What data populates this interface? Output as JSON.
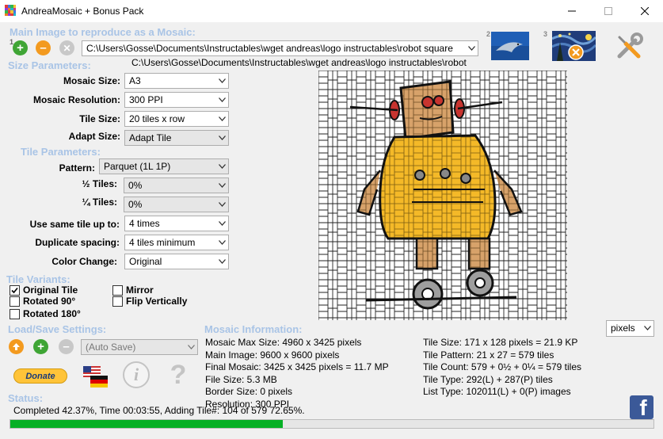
{
  "window": {
    "title": "AndreaMosaic + Bonus Pack"
  },
  "main_image": {
    "section_label": "Main Image to reproduce as a Mosaic:",
    "path_value": "C:\\Users\\Gosse\\Documents\\Instructables\\wget andreas\\logo instructables\\robot square",
    "path_caption": "C:\\Users\\Gosse\\Documents\\Instructables\\wget andreas\\logo instructables\\robot",
    "badge_add": "1",
    "badge_dolphin": "2",
    "badge_starry": "3"
  },
  "size_params": {
    "section_label": "Size Parameters:",
    "mosaic_size_label": "Mosaic Size:",
    "mosaic_size_value": "A3",
    "mosaic_resolution_label": "Mosaic Resolution:",
    "mosaic_resolution_value": "300 PPI",
    "tile_size_label": "Tile Size:",
    "tile_size_value": "20 tiles x row",
    "adapt_size_label": "Adapt Size:",
    "adapt_size_value": "Adapt Tile"
  },
  "tile_params": {
    "section_label": "Tile Parameters:",
    "pattern_label": "Pattern:",
    "pattern_value": "Parquet (1L 1P)",
    "half_tiles_label": "½ Tiles:",
    "half_tiles_value": "0%",
    "quarter_tiles_label": "¼ Tiles:",
    "quarter_tiles_value": "0%",
    "same_tile_label": "Use same tile up to:",
    "same_tile_value": "4 times",
    "dup_spacing_label": "Duplicate spacing:",
    "dup_spacing_value": "4 tiles minimum",
    "color_change_label": "Color Change:",
    "color_change_value": "Original"
  },
  "tile_variants": {
    "section_label": "Tile Variants:",
    "original_tile": "Original Tile",
    "original_tile_checked": true,
    "mirror": "Mirror",
    "mirror_checked": false,
    "rotated_90": "Rotated 90°",
    "rotated_90_checked": false,
    "flip_vertically": "Flip Vertically",
    "flip_vertically_checked": false,
    "rotated_180": "Rotated 180°",
    "rotated_180_checked": false
  },
  "load_save": {
    "section_label": "Load/Save Settings:",
    "auto_save_value": "(Auto Save)",
    "donate_label": "Donate"
  },
  "mosaic_info": {
    "section_label": "Mosaic Information:",
    "units_value": "pixels",
    "left_lines": [
      "Mosaic Max Size: 4960 x 3425 pixels",
      "Main Image: 9600 x 9600 pixels",
      "Final Mosaic: 3425 x 3425 pixels = 11.7 MP",
      "File Size: 5.3 MB",
      "Border Size: 0 pixels",
      "Resolution: 300 PPI"
    ],
    "right_lines": [
      "Tile Size: 171 x 128 pixels = 21.9 KP",
      "Tile Pattern: 21 x 27 = 579 tiles",
      "Tile Count: 579 + 0½ + 0¼ = 579 tiles",
      "Tile Type: 292(L) + 287(P) tiles",
      "List Type: 102011(L) + 0(P) images"
    ]
  },
  "status": {
    "section_label": "Status:",
    "text": "Completed 42.37%, Time 00:03:55, Adding Tile#: 104 of 579 72.65%.",
    "progress_percent": 42.37
  },
  "colors": {
    "section_heading": "#a9c4e6",
    "progress_fill": "#06b025",
    "robot_yellow": "#f4b928",
    "robot_tan": "#d7a26a",
    "facebook_blue": "#3b5998"
  }
}
